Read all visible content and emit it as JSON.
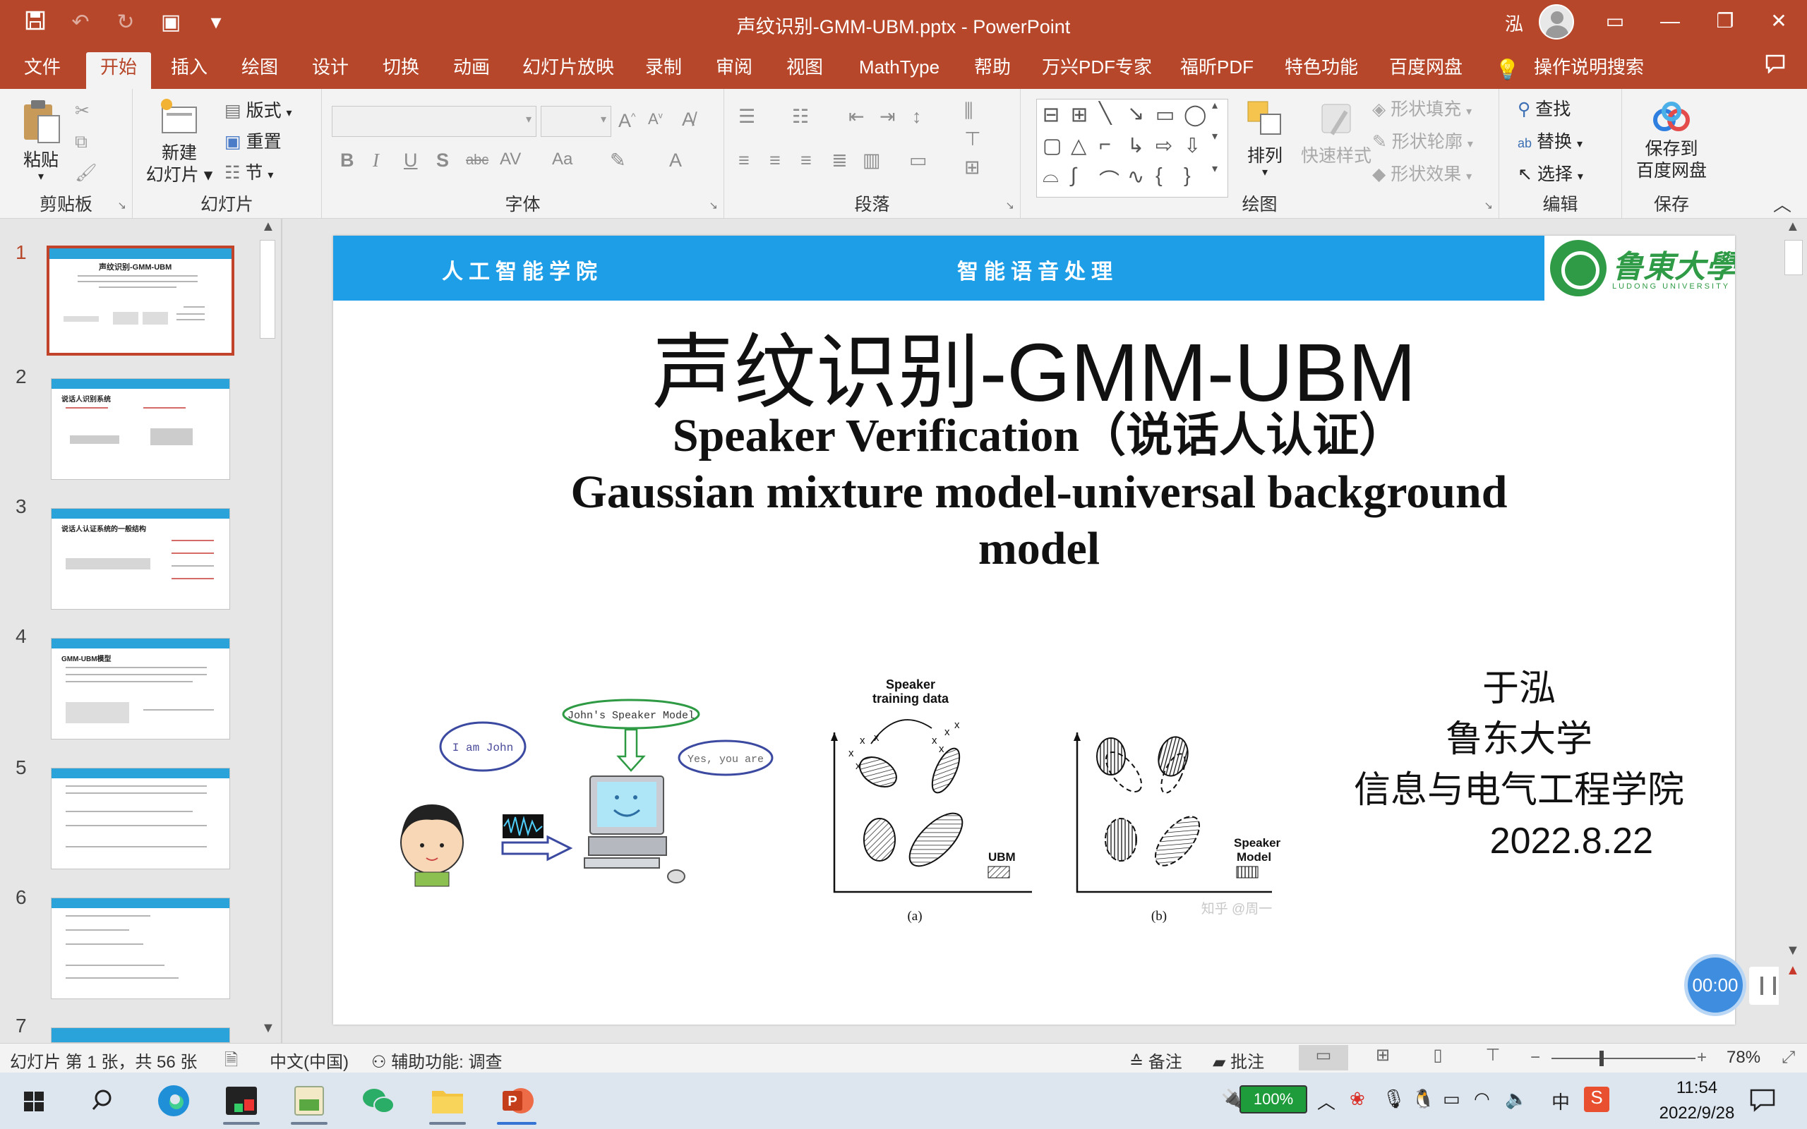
{
  "window": {
    "title": "声纹识别-GMM-UBM.pptx  -  PowerPoint",
    "user_initial": "泓",
    "qat": {
      "save": "save-icon",
      "undo": "undo-icon",
      "redo": "redo-icon",
      "present": "present-icon",
      "customize": "▾"
    },
    "buttons": {
      "ribbon_display": "▭",
      "minimize": "—",
      "restore": "❐",
      "close": "✕"
    }
  },
  "tabs": [
    "文件",
    "开始",
    "插入",
    "绘图",
    "设计",
    "切换",
    "动画",
    "幻灯片放映",
    "录制",
    "审阅",
    "视图",
    "MathType",
    "帮助",
    "万兴PDF专家",
    "福昕PDF",
    "特色功能",
    "百度网盘"
  ],
  "active_tab": "开始",
  "tell_me": "操作说明搜索",
  "ribbon": {
    "clipboard": {
      "label": "剪贴板",
      "paste": "粘贴"
    },
    "slides": {
      "label": "幻灯片",
      "new_line1": "新建",
      "new_line2": "幻灯片",
      "layout": "版式",
      "reset": "重置",
      "section": "节"
    },
    "font": {
      "label": "字体",
      "bold": "B",
      "italic": "I",
      "underline": "U",
      "shadow": "S",
      "strike": "abc",
      "spacing": "AV",
      "case": "Aa",
      "color": "A"
    },
    "paragraph": {
      "label": "段落"
    },
    "drawing": {
      "label": "绘图",
      "arrange": "排列",
      "quick_styles": "快速样式",
      "fill": "形状填充",
      "outline": "形状轮廓",
      "effects": "形状效果"
    },
    "editing": {
      "label": "编辑",
      "find": "查找",
      "replace": "替换",
      "select": "选择"
    },
    "save": {
      "label": "保存",
      "line1": "保存到",
      "line2": "百度网盘"
    }
  },
  "thumbnails": [
    {
      "num": "1",
      "title": "声纹识别-GMM-UBM"
    },
    {
      "num": "2",
      "title": "说话人识别系统"
    },
    {
      "num": "3",
      "title": "说话人认证系统的一般结构"
    },
    {
      "num": "4",
      "title": "GMM-UBM模型"
    },
    {
      "num": "5",
      "title": ""
    },
    {
      "num": "6",
      "title": ""
    },
    {
      "num": "7",
      "title": ""
    }
  ],
  "slide": {
    "header_left": "人工智能学院",
    "header_mid": "智能语音处理",
    "university_cn": "鲁東大學",
    "university_en": "LUDONG UNIVERSITY",
    "title": "声纹识别-GMM-UBM",
    "subtitle_line1": "Speaker Verification（说话人认证）",
    "subtitle_line2": "Gaussian mixture model-universal background",
    "subtitle_line3": "model",
    "author": "于泓",
    "affiliation": "鲁东大学",
    "school": "信息与电气工程学院",
    "date": "2022.8.22",
    "figure": {
      "bubble_left": "I am John",
      "bubble_top": "John's Speaker Model",
      "bubble_right": "Yes, you are",
      "chart_a_title_1": "Speaker",
      "chart_a_title_2": "training data",
      "chart_a_tag": "UBM",
      "chart_a_caption": "(a)",
      "chart_b_tag_1": "Speaker",
      "chart_b_tag_2": "Model",
      "chart_b_caption": "(b)",
      "watermark": "知乎 @周一"
    }
  },
  "recording": {
    "timer": "00:00"
  },
  "statusbar": {
    "slide_info": "幻灯片 第 1 张，共 56 张",
    "language": "中文(中国)",
    "accessibility": "辅助功能: 调查",
    "notes": "备注",
    "comments": "批注",
    "zoom": "78%"
  },
  "taskbar": {
    "battery": "100%",
    "time": "11:54",
    "date": "2022/9/28",
    "ime": "中"
  }
}
